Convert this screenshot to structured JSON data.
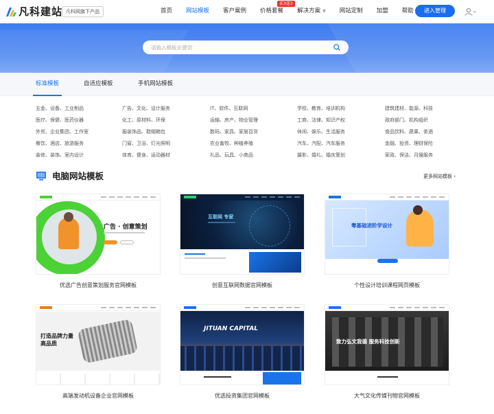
{
  "header": {
    "logo_text": "凡科建站",
    "sub_badge": "凡科网旗下产品",
    "nav": [
      {
        "label": "首页",
        "active": false
      },
      {
        "label": "网站模板",
        "active": true
      },
      {
        "label": "客户案例",
        "active": false
      },
      {
        "label": "价格套餐",
        "active": false
      },
      {
        "label": "解决方案",
        "active": false,
        "dropdown": true
      },
      {
        "label": "网站定制",
        "active": false
      },
      {
        "label": "加盟",
        "active": false
      },
      {
        "label": "帮助",
        "active": false
      }
    ],
    "hot_badge": "买3送3",
    "login_button": "进入管理",
    "user_icon": "user-icon"
  },
  "search": {
    "placeholder": "请输入模板关键词",
    "value": "",
    "icon": "search-icon"
  },
  "tabs": [
    {
      "label": "标准模板",
      "active": true
    },
    {
      "label": "自适应模板",
      "active": false
    },
    {
      "label": "手机网站模板",
      "active": false
    }
  ],
  "categories": [
    [
      "五金、设备、工业制品",
      "广告、文化、设计服务",
      "IT、软件、互联网",
      "学校、教育、培训机构",
      "建筑建材、能源、科技"
    ],
    [
      "医疗、保健、医药仪器",
      "化工、原材料、环保",
      "运输、房产、物业管理",
      "工商、法律、知识产权",
      "政府部门、机构组织"
    ],
    [
      "外贸、企业集团、工作室",
      "服装饰品、鞋帽箱包",
      "数码、家具、家居百货",
      "休闲、娱乐、生活服务",
      "食品饮料、蔬果、茶酒"
    ],
    [
      "餐饮、酒店、旅游服务",
      "门窗、卫浴、灯光照明",
      "农业畜牧、种植养殖",
      "汽车、汽配、汽车服务",
      "金融、投资、理财保险"
    ],
    [
      "装修、装饰、室内设计",
      "体育、健身、运动器材",
      "礼品、玩具、小商品",
      "摄影、婚礼、婚庆策划",
      "家政、保洁、月嫂服务"
    ]
  ],
  "section": {
    "title": "电脑网站模板",
    "more_link": "更多网站模板",
    "icon": "monitor-icon"
  },
  "templates": [
    {
      "title": "优选广告创意策划服务官网模板",
      "thumb_text": "广告 · 创意策划"
    },
    {
      "title": "创意互联网数据官网模板",
      "thumb_text": "互联网 专家"
    },
    {
      "title": "个性设计培训课程网页模板",
      "thumb_text": "零基础进阶学设计"
    },
    {
      "title": "高端发动机设备企业官网模板",
      "thumb_text": "打造品牌力量 高品质"
    },
    {
      "title": "优选投资集团官网模板",
      "thumb_text": "JITUAN CAPITAL"
    },
    {
      "title": "大气文化传媒刊物官网模板",
      "thumb_text": "致力弘文我德  服务科技创新"
    }
  ],
  "colors": {
    "accent": "#1a73e8",
    "button": "#1a6df0",
    "banner": "#4a86f0",
    "hot": "#e8322d"
  }
}
